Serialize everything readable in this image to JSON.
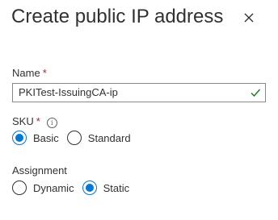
{
  "header": {
    "title": "Create public IP address",
    "close_icon": "close-icon"
  },
  "name_field": {
    "label": "Name",
    "required_mark": "*",
    "value": "PKITest-IssuingCA-ip",
    "valid_icon": "checkmark-icon",
    "valid_color": "#107c10"
  },
  "sku": {
    "label": "SKU",
    "required_mark": "*",
    "info_icon": "info-icon",
    "info_glyph": "i",
    "options": [
      "Basic",
      "Standard"
    ],
    "selected": "Basic"
  },
  "assignment": {
    "label": "Assignment",
    "options": [
      "Dynamic",
      "Static"
    ],
    "selected": "Static"
  },
  "colors": {
    "accent": "#0078d4",
    "required": "#a4262c",
    "text": "#323130"
  }
}
